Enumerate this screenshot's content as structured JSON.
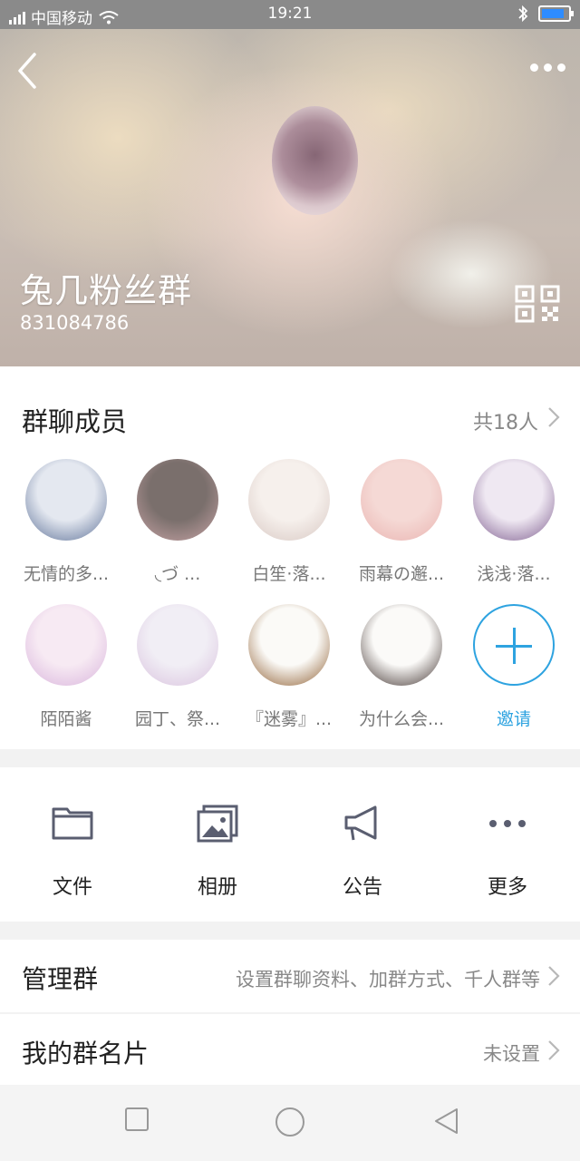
{
  "status_bar": {
    "carrier": "中国移动",
    "time": "19:21",
    "battery_level": 0.85
  },
  "header": {
    "group_name": "兔几粉丝群",
    "group_id": "831084786"
  },
  "members": {
    "title": "群聊成员",
    "count_label": "共18人",
    "list": [
      {
        "name": "无情的多...",
        "colors": [
          "#e4e8f0",
          "#5b6f96"
        ]
      },
      {
        "name": "◟づ ...",
        "colors": [
          "#7a6f6c",
          "#c8a4a6"
        ]
      },
      {
        "name": "白笙·落...",
        "colors": [
          "#f6f0ec",
          "#d7c7c2"
        ]
      },
      {
        "name": "雨幕の邂...",
        "colors": [
          "#f5d9d5",
          "#e9b3b0"
        ]
      },
      {
        "name": "浅浅·落...",
        "colors": [
          "#efe8f2",
          "#7b5a8c"
        ]
      },
      {
        "name": "陌陌酱",
        "colors": [
          "#f7eaf3",
          "#d8b3dc"
        ]
      },
      {
        "name": "园丁、祭...",
        "colors": [
          "#f1eef5",
          "#d9c2de"
        ]
      },
      {
        "name": "『迷雾』...",
        "colors": [
          "#fbfaf7",
          "#8b5a2c"
        ]
      },
      {
        "name": "为什么会...",
        "colors": [
          "#fbfaf8",
          "#3c2e2b"
        ]
      }
    ],
    "invite_label": "邀请"
  },
  "tools": [
    {
      "label": "文件",
      "icon": "folder-icon"
    },
    {
      "label": "相册",
      "icon": "album-icon"
    },
    {
      "label": "公告",
      "icon": "megaphone-icon"
    },
    {
      "label": "更多",
      "icon": "more-dots-icon"
    }
  ],
  "settings": {
    "manage": {
      "title": "管理群",
      "value": "设置群聊资料、加群方式、千人群等"
    },
    "card": {
      "title": "我的群名片",
      "value": "未设置"
    }
  },
  "colors": {
    "accent": "#2ea3e0",
    "icon": "#5a5e70"
  }
}
